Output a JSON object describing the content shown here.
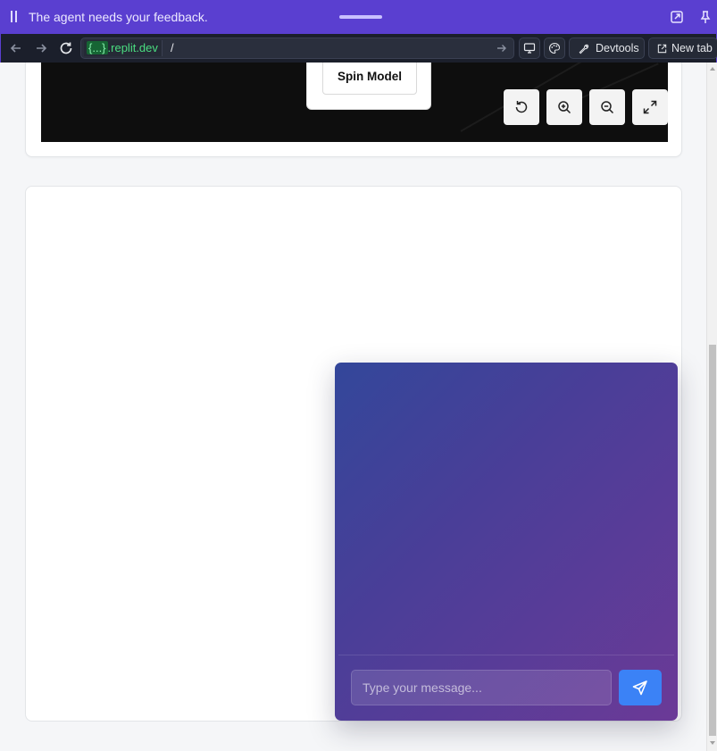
{
  "banner": {
    "message": "The agent needs your feedback.",
    "pause_icon": "pause-icon",
    "popout_icon": "popout-icon",
    "pin_icon": "pin-icon",
    "background": "#5a3fd0"
  },
  "toolbar": {
    "url_host_brace": "{...}",
    "url_host_domain": ".replit.dev",
    "url_path": "/",
    "devtools_label": "Devtools",
    "new_tab_label": "New tab"
  },
  "viewer": {
    "spin_button_label": "Spin Model",
    "controls": [
      "reset-icon",
      "zoom-in-icon",
      "zoom-out-icon",
      "fullscreen-icon"
    ]
  },
  "chat": {
    "input_placeholder": "Type your message...",
    "input_value": "",
    "send_icon": "send-icon",
    "send_color": "#3b82f6"
  }
}
